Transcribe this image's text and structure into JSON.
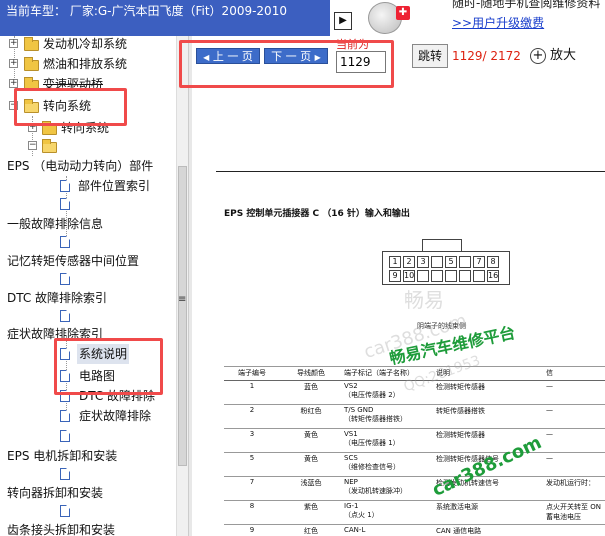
{
  "header": {
    "car_model_text": "当前车型： 厂家:G-广汽本田飞度（Fit）2009-2010",
    "nav_arrow": "▶",
    "ad_line1": "随时-随地手机查阅维修资料",
    "ad_line2": ">>用户升级缴费"
  },
  "sidebar": {
    "items": [
      {
        "label": "发动机冷却系统"
      },
      {
        "label": "燃油和排放系统"
      },
      {
        "label": "变速驱动桥"
      },
      {
        "label": "转向系统"
      },
      {
        "label": "转向系统"
      },
      {
        "label": "EPS （电动动力转向）部件"
      },
      {
        "label": "部件位置索引"
      },
      {
        "label": "一般故障排除信息"
      },
      {
        "label": "记忆转矩传感器中间位置"
      },
      {
        "label": "DTC 故障排除索引"
      },
      {
        "label": "症状故障排除索引"
      },
      {
        "label": "系统说明"
      },
      {
        "label": "电路图"
      },
      {
        "label": "DTC 故障排除"
      },
      {
        "label": "症状故障排除"
      },
      {
        "label": "EPS 电机拆卸和安装"
      },
      {
        "label": "转向器拆卸和安装"
      },
      {
        "label": "齿条接头拆卸和安装"
      }
    ]
  },
  "toolbar": {
    "prev_label": "上 一 页",
    "next_label": "下 一 页",
    "current_page_label": "当前为",
    "current_page_value": "1129",
    "jump_label": "跳转",
    "page_count": "1129/ 2172",
    "zoom_label": "放大"
  },
  "document": {
    "heading": "EPS 控制单元插接器 C （16 针）输入和输出",
    "connector_pins_row1": [
      "1",
      "2",
      "3",
      "",
      "5",
      "",
      "7",
      "8"
    ],
    "connector_pins_row2": [
      "9",
      "10",
      "",
      "",
      "",
      "",
      "",
      "16"
    ],
    "connector_caption": "阴端子的线束侧",
    "table": {
      "headers": [
        "端子编号",
        "导线颜色",
        "端子标记（端子名称）",
        "说明",
        "信"
      ],
      "rows": [
        {
          "no": "1",
          "color": "蓝色",
          "term": "VS2",
          "term_sub": "（电压传感器 2）",
          "desc": "检测转矩传感器",
          "extra": "—"
        },
        {
          "no": "2",
          "color": "粉红色",
          "term": "T/S GND",
          "term_sub": "（转矩传感器搭铁）",
          "desc": "转矩传感器搭铁",
          "extra": "—"
        },
        {
          "no": "3",
          "color": "黄色",
          "term": "VS1",
          "term_sub": "（电压传感器 1）",
          "desc": "检测转矩传感器",
          "extra": "—"
        },
        {
          "no": "5",
          "color": "黄色",
          "term": "SCS",
          "term_sub": "（维修检查信号）",
          "desc": "检测转矩传感器信号",
          "extra": "—"
        },
        {
          "no": "7",
          "color": "浅蓝色",
          "term": "NEP",
          "term_sub": "（发动机转速脉冲）",
          "desc": "检测发动机转速信号",
          "extra": "发动机运行时："
        },
        {
          "no": "8",
          "color": "紫色",
          "term": "IG-1",
          "term_sub": "（点火 1）",
          "desc": "系统激活电源",
          "extra": "点火开关转至 ON 蓄电池电压"
        },
        {
          "no": "9",
          "color": "红色",
          "term": "CAN-L",
          "term_sub": "",
          "desc": "CAN 通信电路",
          "extra": ""
        }
      ]
    }
  },
  "watermarks": {
    "w1": "畅易",
    "w2": "car388.com",
    "w3": "畅易汽车维修平台",
    "w4": "QQ:201953",
    "w5": "car388.com"
  },
  "colors": {
    "title_bar_bg": "#3c5fc0",
    "page_button_bg": "#3d6cc9",
    "highlight_red": "#f04a4a",
    "watermark_green": "#1e9c3a"
  }
}
